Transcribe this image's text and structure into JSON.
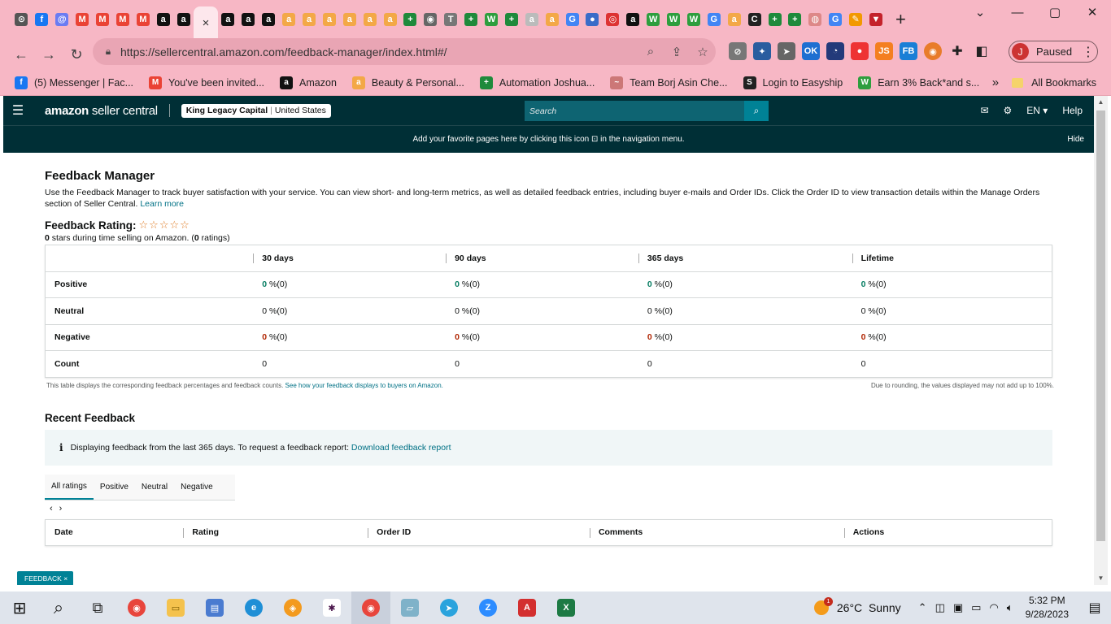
{
  "browser": {
    "tabs": [
      {
        "icon": "chrome-icon",
        "glyph": "⊙",
        "color": "#555"
      },
      {
        "icon": "facebook-icon",
        "glyph": "f",
        "color": "#1877f2"
      },
      {
        "icon": "messenger-icon",
        "glyph": "@",
        "color": "#6a7cf2"
      },
      {
        "icon": "gmail-icon",
        "glyph": "M",
        "color": "#ea4335"
      },
      {
        "icon": "gmail-icon",
        "glyph": "M",
        "color": "#ea4335"
      },
      {
        "icon": "gmail-icon",
        "glyph": "M",
        "color": "#ea4335"
      },
      {
        "icon": "gmail-icon",
        "glyph": "M",
        "color": "#ea4335"
      },
      {
        "icon": "amazon-icon",
        "glyph": "a",
        "color": "#111"
      },
      {
        "icon": "amazon-icon",
        "glyph": "a",
        "color": "#111"
      },
      {
        "icon": "active-tab-close-icon",
        "glyph": "×",
        "color": "active"
      },
      {
        "icon": "amazon-icon",
        "glyph": "a",
        "color": "#111"
      },
      {
        "icon": "amazon-icon",
        "glyph": "a",
        "color": "#111"
      },
      {
        "icon": "amazon-icon",
        "glyph": "a",
        "color": "#111"
      },
      {
        "icon": "amazon-smile-icon",
        "glyph": "a",
        "color": "#f3a847"
      },
      {
        "icon": "amazon-smile-icon",
        "glyph": "a",
        "color": "#f3a847"
      },
      {
        "icon": "amazon-smile-icon",
        "glyph": "a",
        "color": "#f3a847"
      },
      {
        "icon": "amazon-smile-icon",
        "glyph": "a",
        "color": "#f3a847"
      },
      {
        "icon": "amazon-smile-icon",
        "glyph": "a",
        "color": "#f3a847"
      },
      {
        "icon": "amazon-smile-icon",
        "glyph": "a",
        "color": "#f3a847"
      },
      {
        "icon": "sheets-plus-icon",
        "glyph": "+",
        "color": "#1f8a3b"
      },
      {
        "icon": "globe-icon",
        "glyph": "◉",
        "color": "#666"
      },
      {
        "icon": "t-icon",
        "glyph": "T",
        "color": "#777"
      },
      {
        "icon": "sheets-plus-icon",
        "glyph": "+",
        "color": "#1f8a3b"
      },
      {
        "icon": "w-icon",
        "glyph": "W",
        "color": "#2e9e3e"
      },
      {
        "icon": "sheets-plus-icon",
        "glyph": "+",
        "color": "#1f8a3b"
      },
      {
        "icon": "lock-icon",
        "glyph": "a",
        "color": "#bbb"
      },
      {
        "icon": "amazon-smile-icon",
        "glyph": "a",
        "color": "#f3a847"
      },
      {
        "icon": "google-icon",
        "glyph": "G",
        "color": "#4285f4"
      },
      {
        "icon": "circle-icon",
        "glyph": "●",
        "color": "#3a6cc8"
      },
      {
        "icon": "target-icon",
        "glyph": "◎",
        "color": "#d33"
      },
      {
        "icon": "amazon-icon",
        "glyph": "a",
        "color": "#111"
      },
      {
        "icon": "w-icon",
        "glyph": "W",
        "color": "#2e9e3e"
      },
      {
        "icon": "w-icon",
        "glyph": "W",
        "color": "#2e9e3e"
      },
      {
        "icon": "w-icon",
        "glyph": "W",
        "color": "#2e9e3e"
      },
      {
        "icon": "google-icon",
        "glyph": "G",
        "color": "#4285f4"
      },
      {
        "icon": "amazon-smile-icon",
        "glyph": "a",
        "color": "#f3a847"
      },
      {
        "icon": "c-icon",
        "glyph": "C",
        "color": "#222"
      },
      {
        "icon": "sheets-plus-icon",
        "glyph": "+",
        "color": "#1f8a3b"
      },
      {
        "icon": "sheets-plus-icon",
        "glyph": "+",
        "color": "#1f8a3b"
      },
      {
        "icon": "shield-icon",
        "glyph": "◍",
        "color": "#d88"
      },
      {
        "icon": "google-icon",
        "glyph": "G",
        "color": "#4285f4"
      },
      {
        "icon": "pencil-icon",
        "glyph": "✎",
        "color": "#f29900"
      },
      {
        "icon": "filter-icon",
        "glyph": "▼",
        "color": "#c4222b"
      }
    ],
    "new_tab": "+",
    "window": {
      "minimize": "⌄",
      "restore": "▢",
      "maximize": "☐",
      "close": "✕"
    },
    "url": "https://sellercentral.amazon.com/feedback-manager/index.html#/",
    "profile_initial": "J",
    "profile_status": "Paused",
    "bookmarks": [
      {
        "icon": "facebook-icon",
        "glyph": "f",
        "color": "#1877f2",
        "label": "(5) Messenger | Fac..."
      },
      {
        "icon": "gmail-icon",
        "glyph": "M",
        "color": "#ea4335",
        "label": "You've been invited..."
      },
      {
        "icon": "amazon-icon",
        "glyph": "a",
        "color": "#111",
        "label": "Amazon"
      },
      {
        "icon": "amazon-smile-icon",
        "glyph": "a",
        "color": "#f3a847",
        "label": "Beauty & Personal..."
      },
      {
        "icon": "sheets-plus-icon",
        "glyph": "+",
        "color": "#1f8a3b",
        "label": "Automation Joshua..."
      },
      {
        "icon": "team-icon",
        "glyph": "~",
        "color": "#c77",
        "label": "Team Borj Asin Che..."
      },
      {
        "icon": "easyship-icon",
        "glyph": "S",
        "color": "#222",
        "label": "Login to Easyship"
      },
      {
        "icon": "w-icon",
        "glyph": "W",
        "color": "#2e9e3e",
        "label": "Earn 3% Back*and s..."
      }
    ],
    "bookmarks_overflow": "»",
    "all_bookmarks": "All Bookmarks"
  },
  "seller": {
    "logo_bold": "amazon",
    "logo_rest": " seller central",
    "account_name": "King Legacy Capital",
    "account_sep": "|",
    "account_region": "United States",
    "search_placeholder": "Search",
    "lang": "EN ▾",
    "help": "Help",
    "fav_banner": "Add your favorite pages here by clicking this icon ⊡ in the navigation menu.",
    "fav_hide": "Hide"
  },
  "feedback": {
    "title": "Feedback Manager",
    "description": "Use the Feedback Manager to track buyer satisfaction with your service. You can view short- and long-term metrics, as well as detailed feedback entries, including buyer e-mails and Order IDs. Click the Order ID to view transaction details within the Manage Orders section of Seller Central.",
    "learn_more": "Learn more",
    "rating_label": "Feedback Rating:",
    "stars": "☆☆☆☆☆",
    "rating_stars_count": "0",
    "rating_sub_1": " stars during time selling on Amazon. (",
    "rating_count": "0",
    "rating_sub_2": " ratings)",
    "columns": [
      "",
      "30 days",
      "90 days",
      "365 days",
      "Lifetime"
    ],
    "rows": [
      {
        "label": "Positive",
        "cells": [
          {
            "v": "0",
            "suffix": " %(0)",
            "cls": "g"
          },
          {
            "v": "0",
            "suffix": " %(0)",
            "cls": "g"
          },
          {
            "v": "0",
            "suffix": " %(0)",
            "cls": "g"
          },
          {
            "v": "0",
            "suffix": " %(0)",
            "cls": "g"
          }
        ]
      },
      {
        "label": "Neutral",
        "cells": [
          {
            "v": "0",
            "suffix": " %(0)",
            "cls": "n"
          },
          {
            "v": "0",
            "suffix": " %(0)",
            "cls": "n"
          },
          {
            "v": "0",
            "suffix": " %(0)",
            "cls": "n"
          },
          {
            "v": "0",
            "suffix": " %(0)",
            "cls": "n"
          }
        ]
      },
      {
        "label": "Negative",
        "cells": [
          {
            "v": "0",
            "suffix": " %(0)",
            "cls": "r"
          },
          {
            "v": "0",
            "suffix": " %(0)",
            "cls": "r"
          },
          {
            "v": "0",
            "suffix": " %(0)",
            "cls": "r"
          },
          {
            "v": "0",
            "suffix": " %(0)",
            "cls": "r"
          }
        ]
      },
      {
        "label": "Count",
        "cells": [
          {
            "v": "0",
            "suffix": "",
            "cls": "n"
          },
          {
            "v": "0",
            "suffix": "",
            "cls": "n"
          },
          {
            "v": "0",
            "suffix": "",
            "cls": "n"
          },
          {
            "v": "0",
            "suffix": "",
            "cls": "n"
          }
        ]
      }
    ],
    "table_note": "This table displays the corresponding feedback percentages and feedback counts.",
    "table_note_link": "See how your feedback displays to buyers on Amazon.",
    "rounding_note": "Due to rounding, the values displayed may not add up to 100%.",
    "recent_title": "Recent Feedback",
    "info_text": "Displaying feedback from the last 365 days. To request a feedback report:",
    "info_link": "Download feedback report",
    "filter_tabs": [
      "All ratings",
      "Positive",
      "Neutral",
      "Negative"
    ],
    "pager_prev": "‹",
    "pager_next": "›",
    "recent_columns": [
      "Date",
      "Rating",
      "Order ID",
      "Comments",
      "Actions"
    ],
    "feedback_button": "FEEDBACK",
    "feedback_close": "×"
  },
  "taskbar": {
    "weather_temp": "26°C",
    "weather_text": "Sunny",
    "weather_badge": "1",
    "time": "5:32 PM",
    "date": "9/28/2023"
  }
}
